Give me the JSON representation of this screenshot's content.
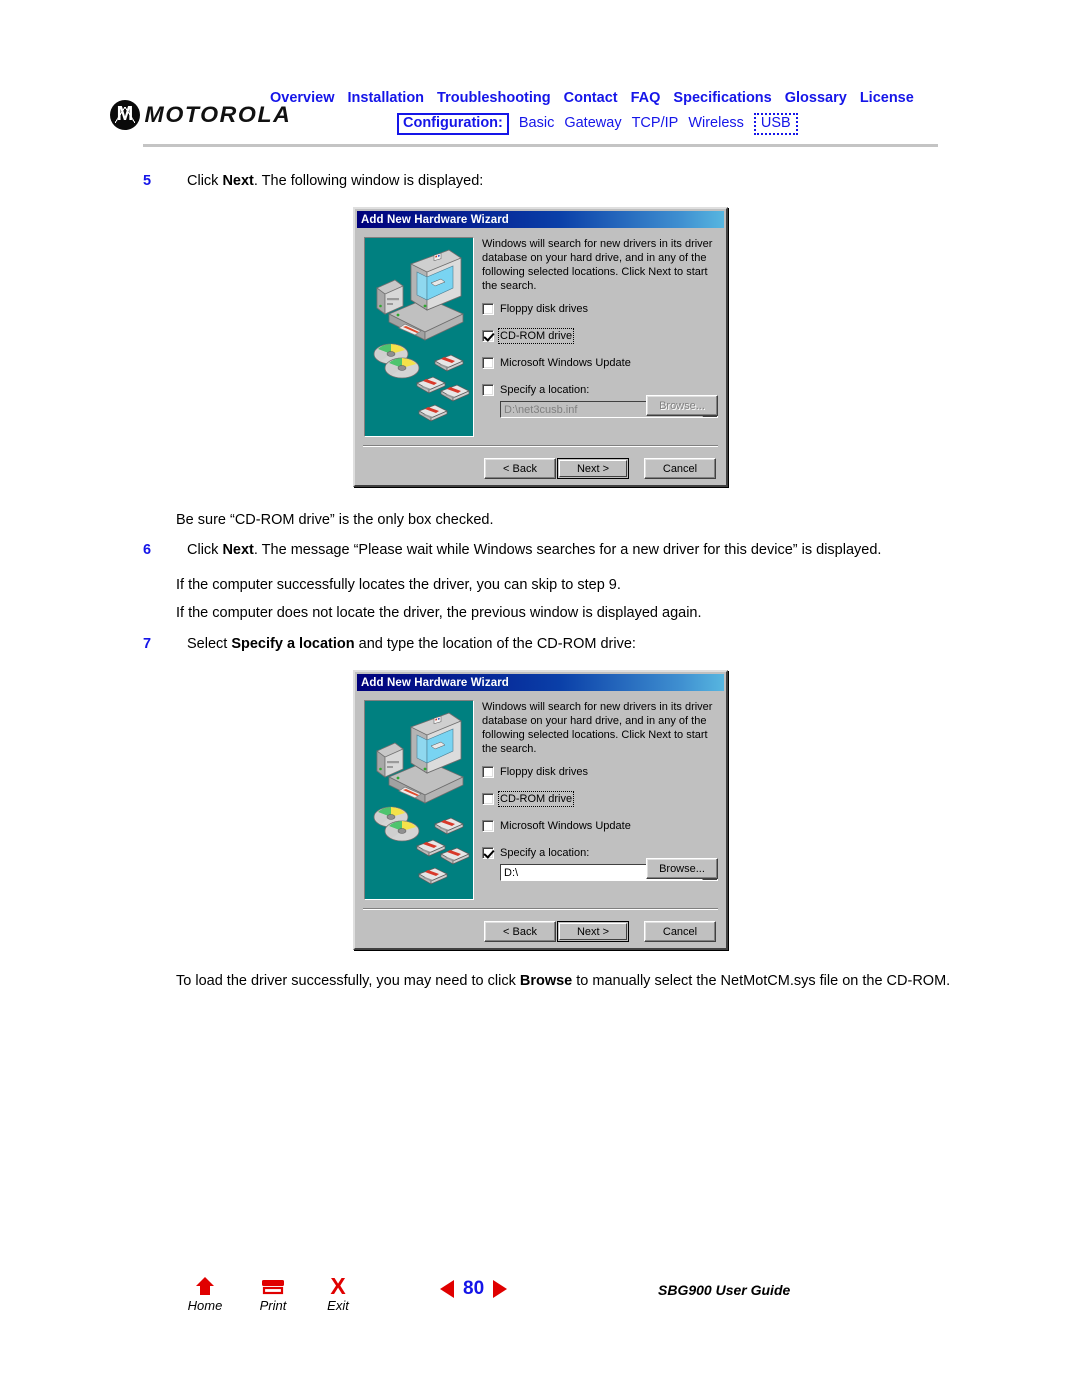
{
  "header": {
    "brand": "MOTOROLA",
    "nav_primary": [
      {
        "label": "Overview"
      },
      {
        "label": "Installation"
      },
      {
        "label": "Troubleshooting"
      },
      {
        "label": "Contact"
      },
      {
        "label": "FAQ"
      },
      {
        "label": "Specifications"
      },
      {
        "label": "Glossary"
      },
      {
        "label": "License"
      }
    ],
    "nav_secondary": [
      {
        "label": "Configuration:",
        "style": "boxed"
      },
      {
        "label": "Basic",
        "style": "plain"
      },
      {
        "label": "Gateway",
        "style": "plain"
      },
      {
        "label": "TCP/IP",
        "style": "plain"
      },
      {
        "label": "Wireless",
        "style": "plain"
      },
      {
        "label": "USB",
        "style": "dotted"
      }
    ],
    "accent_color": "#1515e8"
  },
  "content": {
    "step5": {
      "number": "5",
      "text_before": "Click ",
      "bold": "Next",
      "text_after": ". The following window is displayed:"
    },
    "note_after_dialog1": "Be sure “CD-ROM drive” is the only box checked.",
    "step6": {
      "number": "6",
      "text_before": "Click ",
      "bold": "Next",
      "text_after": ". The message “Please wait while Windows searches for a new driver for this device” is displayed.",
      "sub1": "If the computer successfully locates the driver, you can skip to step 9.",
      "sub2": "If the computer does not locate the driver, the previous window is displayed again."
    },
    "step7": {
      "number": "7",
      "text_before": "Select ",
      "bold": "Specify a location",
      "text_after": " and type the location of the CD-ROM drive:"
    },
    "closing": {
      "part1": "To load the driver successfully, you may need to click ",
      "bold": "Browse",
      "part2": " to manually select the NetMotCM.sys file on the CD-ROM."
    }
  },
  "dialog1": {
    "title": "Add New Hardware Wizard",
    "description": "Windows will search for new drivers in its driver database on your hard drive, and in any of the following selected locations. Click Next to start the search.",
    "checkboxes": [
      {
        "label": "Floppy disk drives",
        "mnemonic": "F",
        "checked": false,
        "focused": false
      },
      {
        "label": "CD-ROM drive",
        "mnemonic": "C",
        "checked": true,
        "focused": true
      },
      {
        "label": "Microsoft Windows Update",
        "mnemonic": "M",
        "checked": false,
        "focused": false
      },
      {
        "label": "Specify a location:",
        "mnemonic": "l",
        "checked": false,
        "focused": false
      }
    ],
    "location_value": "D:\\net3cusb.inf",
    "location_disabled": true,
    "browse_label": "Browse...",
    "browse_disabled": true,
    "back_label": "< Back",
    "next_label": "Next >",
    "cancel_label": "Cancel"
  },
  "dialog2": {
    "title": "Add New Hardware Wizard",
    "description": "Windows will search for new drivers in its driver database on your hard drive, and in any of the following selected locations. Click Next to start the search.",
    "checkboxes": [
      {
        "label": "Floppy disk drives",
        "mnemonic": "F",
        "checked": false,
        "focused": false
      },
      {
        "label": "CD-ROM drive",
        "mnemonic": "C",
        "checked": false,
        "focused": true
      },
      {
        "label": "Microsoft Windows Update",
        "mnemonic": "M",
        "checked": false,
        "focused": false
      },
      {
        "label": "Specify a location:",
        "mnemonic": "l",
        "checked": true,
        "focused": false
      }
    ],
    "location_value": "D:\\",
    "location_disabled": false,
    "browse_label": "Browse...",
    "browse_disabled": false,
    "back_label": "< Back",
    "next_label": "Next >",
    "cancel_label": "Cancel"
  },
  "footer": {
    "home_label": "Home",
    "print_label": "Print",
    "exit_label": "Exit",
    "exit_glyph": "X",
    "page_number": "80",
    "guide_title": "SBG900 User Guide",
    "nav_arrow_color": "#e00000"
  }
}
